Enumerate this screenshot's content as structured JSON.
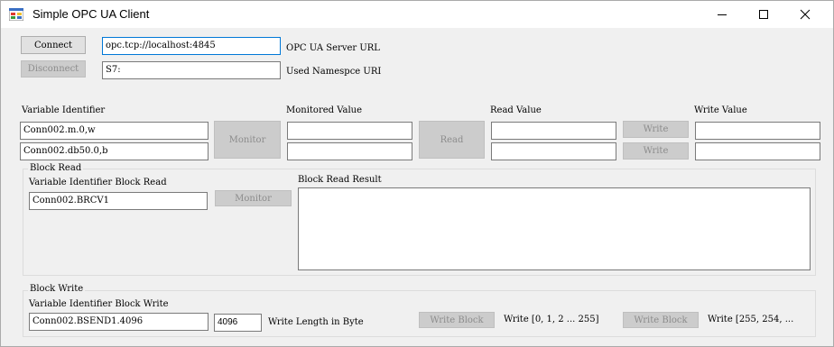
{
  "window": {
    "title": "Simple OPC UA Client"
  },
  "server": {
    "connect_label": "Connect",
    "disconnect_label": "Disconnect",
    "url_value": "opc.tcp://localhost:4845",
    "url_label": "OPC UA Server URL",
    "namespace_value": "S7:",
    "namespace_label": "Used Namespce URI"
  },
  "variables": {
    "identifier_header": "Variable Identifier",
    "monitored_header": "Monitored Value",
    "read_header": "Read Value",
    "write_header": "Write Value",
    "monitor_label": "Monitor",
    "read_label": "Read",
    "write_label": "Write",
    "rows": [
      {
        "identifier": "Conn002.m.0,w",
        "monitored": "",
        "read": "",
        "write": ""
      },
      {
        "identifier": "Conn002.db50.0,b",
        "monitored": "",
        "read": "",
        "write": ""
      }
    ]
  },
  "block_read": {
    "group_title": "Block Read",
    "identifier_label": "Variable Identifier Block Read",
    "identifier_value": "Conn002.BRCV1",
    "monitor_label": "Monitor",
    "result_label": "Block Read Result",
    "result_value": ""
  },
  "block_write": {
    "group_title": "Block Write",
    "identifier_label": "Variable Identifier Block Write",
    "identifier_value": "Conn002.BSEND1.4096",
    "length_value": "4096",
    "length_label": "Write Length in Byte",
    "write_block_label": "Write Block",
    "write_a_text": "Write [0, 1, 2 ... 255]",
    "write_b_text": "Write [255, 254, ..."
  },
  "colors": {
    "focus_border": "#0078d7",
    "disabled_bg": "#cccccc",
    "disabled_text": "#8c8c8c"
  }
}
